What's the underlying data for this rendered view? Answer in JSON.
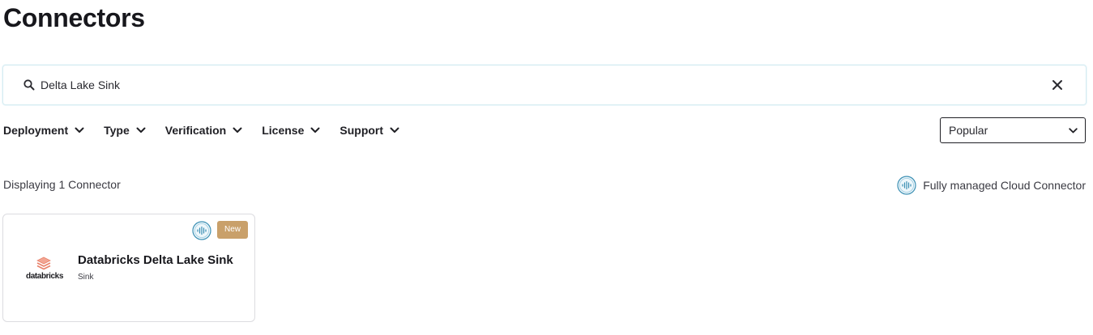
{
  "page_title": "Connectors",
  "search": {
    "value": "Delta Lake Sink",
    "icon": "search-icon",
    "clear_icon": "close-icon"
  },
  "filters": [
    {
      "label": "Deployment",
      "icon": "chevron-down-icon"
    },
    {
      "label": "Type",
      "icon": "chevron-down-icon"
    },
    {
      "label": "Verification",
      "icon": "chevron-down-icon"
    },
    {
      "label": "License",
      "icon": "chevron-down-icon"
    },
    {
      "label": "Support",
      "icon": "chevron-down-icon"
    }
  ],
  "sort": {
    "selected": "Popular",
    "icon": "chevron-down-icon"
  },
  "results": {
    "count_text": "Displaying 1 Connector"
  },
  "legend": {
    "label": "Fully managed Cloud Connector",
    "icon": "cloud-connector-icon"
  },
  "cards": [
    {
      "title": "Databricks Delta Lake Sink",
      "type": "Sink",
      "badge": "New",
      "logo_text": "databricks",
      "cloud_icon": "cloud-connector-icon"
    }
  ],
  "colors": {
    "badge_new": "#c9a06a",
    "cloud_icon": "#3b8fb3",
    "databricks_logo": "#e8826b",
    "search_border": "#d6ecf2"
  }
}
